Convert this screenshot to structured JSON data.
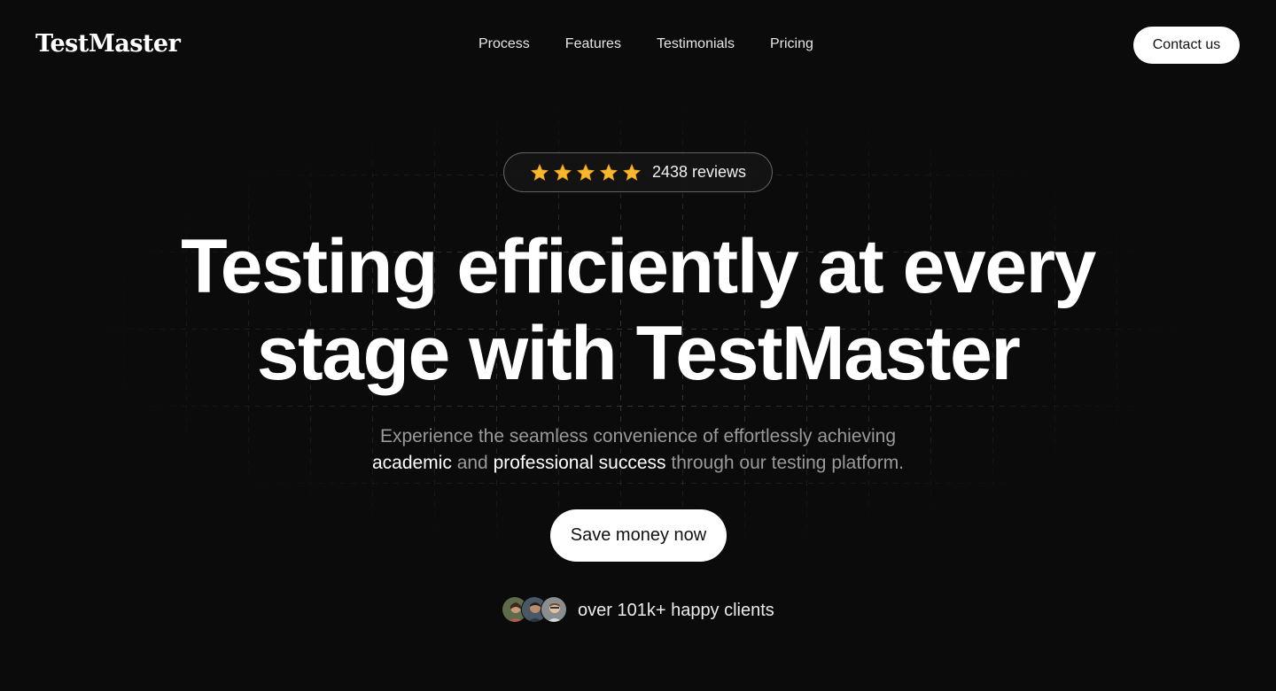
{
  "header": {
    "logo": "TestMaster",
    "nav": [
      {
        "label": "Process"
      },
      {
        "label": "Features"
      },
      {
        "label": "Testimonials"
      },
      {
        "label": "Pricing"
      }
    ],
    "contact_label": "Contact us"
  },
  "hero": {
    "rating": {
      "stars": 5,
      "star_icon": "star-icon",
      "star_color": "#f5b82e",
      "reviews_text": "2438 reviews"
    },
    "headline": {
      "line1": "Testing efficiently at every",
      "line2": "stage with TestMaster"
    },
    "subtext": {
      "part1": "Experience the seamless convenience of effortlessly achieving",
      "highlight1": "academic",
      "part2": "and",
      "highlight2": "professional success",
      "part3": "through our testing platform."
    },
    "cta_label": "Save money now",
    "clients_text": "over 101k+ happy clients",
    "avatars": [
      {
        "icon": "avatar-photo"
      },
      {
        "icon": "avatar-photo"
      },
      {
        "icon": "avatar-photo"
      }
    ]
  },
  "colors": {
    "background": "#0b0b0b",
    "text_primary": "#ffffff",
    "text_muted": "#9a9a9a",
    "button_bg": "#ffffff",
    "button_text": "#111111"
  }
}
